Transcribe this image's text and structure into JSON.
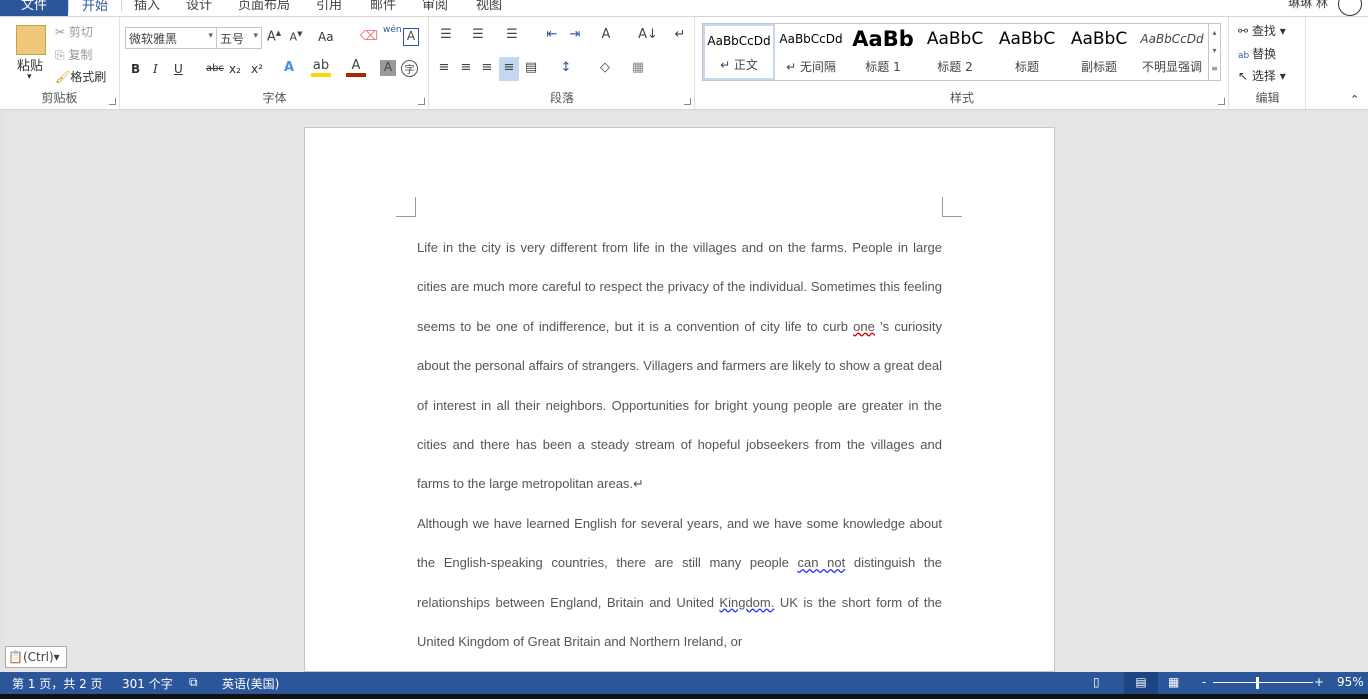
{
  "tabs": [
    "文件",
    "开始",
    "插入",
    "设计",
    "页面布局",
    "引用",
    "邮件",
    "审阅",
    "视图"
  ],
  "user": "琳琳 林",
  "clipboard": {
    "paste": "粘贴",
    "cut": "剪切",
    "copy": "复制",
    "format_painter": "格式刷",
    "label": "剪贴板"
  },
  "font": {
    "name": "微软雅黑",
    "size": "五号",
    "label": "字体",
    "bold": "B",
    "italic": "I",
    "underline": "U",
    "strike": "abc",
    "sub": "x₂",
    "sup": "x²",
    "case": "Aa",
    "phonetic": "wén",
    "border_char": "A",
    "enclose": "字"
  },
  "paragraph": {
    "label": "段落"
  },
  "styles": {
    "label": "样式",
    "items": [
      {
        "sample": "AaBbCcDd",
        "name": "↵ 正文"
      },
      {
        "sample": "AaBbCcDd",
        "name": "↵ 无间隔"
      },
      {
        "sample": "AaBb",
        "name": "标题 1"
      },
      {
        "sample": "AaBbC",
        "name": "标题 2"
      },
      {
        "sample": "AaBbC",
        "name": "标题"
      },
      {
        "sample": "AaBbC",
        "name": "副标题"
      },
      {
        "sample": "AaBbCcDd",
        "name": "不明显强调"
      }
    ]
  },
  "editing": {
    "find": "查找",
    "replace": "替换",
    "select": "选择",
    "label": "编辑"
  },
  "document": {
    "p1": "Life in the city is very different from life in the villages and on the farms. People in large cities are much more careful to respect the privacy of the individual. Sometimes this feeling seems to be one of indifference, but it is a convention of city life to curb ",
    "p1_err": "one",
    "p1b": " ’s curiosity about the personal affairs of strangers. Villagers and farmers are likely to show a great deal of interest in all their neighbors. Opportunities for bright young people are greater in the cities and there has been a steady stream of hopeful jobseekers from the villages and farms to the large metropolitan areas.↵",
    "p2": "Although we have learned English for several years, and we have some knowledge about the English-speaking countries, there are still many people ",
    "p2_err": "can not",
    "p2b": " distinguish the relationships between England, Britain and United ",
    "p2_err2": "Kingdom.",
    "p2c": " UK is the short form of the United Kingdom of Great Britain and Northern Ireland, or"
  },
  "paste_options": "(Ctrl)",
  "status": {
    "page": "第 1 页，共 2 页",
    "words": "301 个字",
    "lang": "英语(美国)",
    "zoom": "95%",
    "zoom_value": 95
  },
  "colors": {
    "accent": "#2b579a",
    "highlight": "#ffd700",
    "font_color": "#a52a00"
  }
}
